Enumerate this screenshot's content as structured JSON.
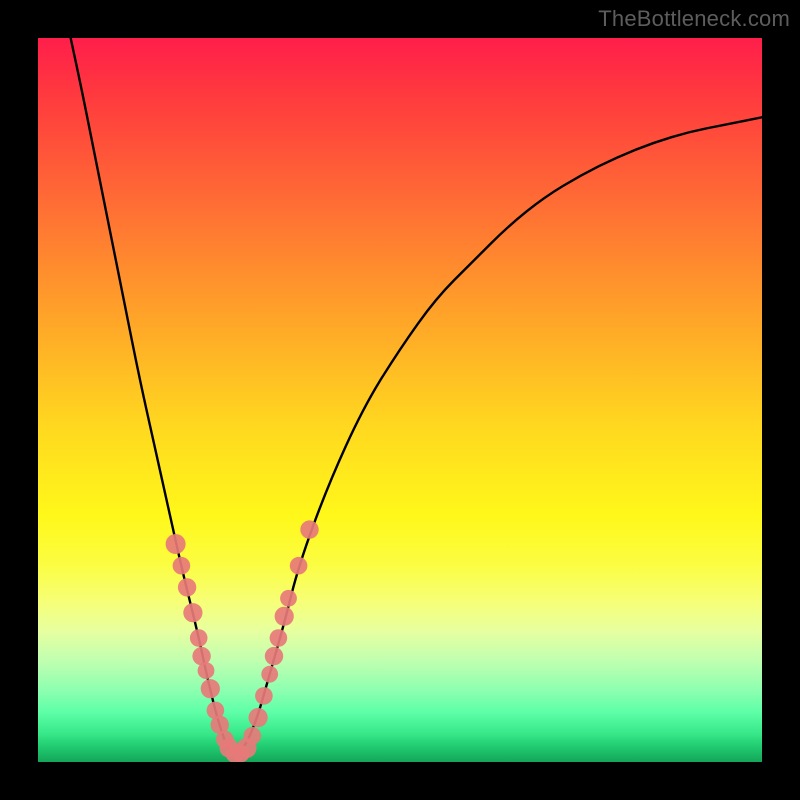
{
  "watermark": "TheBottleneck.com",
  "colors": {
    "frame": "#000000",
    "curve_stroke": "#000000",
    "marker_fill": "#e77a79",
    "gradient_stops": [
      {
        "pct": 0,
        "color": "#ff1e4b"
      },
      {
        "pct": 8,
        "color": "#ff3a3e"
      },
      {
        "pct": 22,
        "color": "#ff6a35"
      },
      {
        "pct": 38,
        "color": "#ffa229"
      },
      {
        "pct": 54,
        "color": "#ffd91f"
      },
      {
        "pct": 66,
        "color": "#fff81a"
      },
      {
        "pct": 73,
        "color": "#fbfd44"
      },
      {
        "pct": 78,
        "color": "#f6ff78"
      },
      {
        "pct": 82,
        "color": "#e6ffa0"
      },
      {
        "pct": 86,
        "color": "#c0ffb0"
      },
      {
        "pct": 90,
        "color": "#8effb0"
      },
      {
        "pct": 93,
        "color": "#5fffa8"
      },
      {
        "pct": 96,
        "color": "#38e98a"
      },
      {
        "pct": 98,
        "color": "#20c96f"
      },
      {
        "pct": 100,
        "color": "#14a559"
      }
    ]
  },
  "chart_data": {
    "type": "line",
    "title": "",
    "xlabel": "",
    "ylabel": "",
    "x_range": [
      0,
      100
    ],
    "y_range": [
      0,
      100
    ],
    "note": "V-shaped bottleneck curve. x is normalized horizontal position (0-100), y is bottleneck percentage (0 = optimal/green, 100 = severe/red). Minimum near x≈27.",
    "series": [
      {
        "name": "bottleneck-curve",
        "x": [
          4.5,
          6,
          8,
          10,
          12,
          14,
          16,
          18,
          20,
          22,
          23.5,
          25,
          26.5,
          28,
          30,
          32,
          34,
          36,
          40,
          45,
          50,
          55,
          60,
          65,
          70,
          75,
          80,
          85,
          90,
          95,
          100
        ],
        "y": [
          100,
          93,
          83,
          73,
          63,
          53,
          44,
          35,
          26,
          18,
          11,
          5,
          1,
          1,
          5,
          12,
          19,
          27,
          38,
          49,
          57,
          64,
          69,
          74,
          78,
          81,
          83.5,
          85.5,
          87,
          88,
          89
        ]
      }
    ],
    "markers": {
      "name": "highlighted-points",
      "note": "Salmon colored dots clustered near the curve minimum, sizes vary.",
      "points": [
        {
          "x": 19.0,
          "y": 30.0,
          "r": 1.5
        },
        {
          "x": 19.8,
          "y": 27.0,
          "r": 1.2
        },
        {
          "x": 20.6,
          "y": 24.0,
          "r": 1.3
        },
        {
          "x": 21.4,
          "y": 20.5,
          "r": 1.4
        },
        {
          "x": 22.2,
          "y": 17.0,
          "r": 1.2
        },
        {
          "x": 22.6,
          "y": 14.5,
          "r": 1.3
        },
        {
          "x": 23.2,
          "y": 12.5,
          "r": 1.1
        },
        {
          "x": 23.8,
          "y": 10.0,
          "r": 1.4
        },
        {
          "x": 24.5,
          "y": 7.0,
          "r": 1.2
        },
        {
          "x": 25.1,
          "y": 5.0,
          "r": 1.3
        },
        {
          "x": 25.8,
          "y": 3.0,
          "r": 1.2
        },
        {
          "x": 26.4,
          "y": 1.8,
          "r": 1.4
        },
        {
          "x": 27.2,
          "y": 1.0,
          "r": 1.3
        },
        {
          "x": 28.0,
          "y": 1.0,
          "r": 1.2
        },
        {
          "x": 28.8,
          "y": 1.8,
          "r": 1.5
        },
        {
          "x": 29.6,
          "y": 3.5,
          "r": 1.2
        },
        {
          "x": 30.4,
          "y": 6.0,
          "r": 1.4
        },
        {
          "x": 31.2,
          "y": 9.0,
          "r": 1.2
        },
        {
          "x": 32.0,
          "y": 12.0,
          "r": 1.1
        },
        {
          "x": 32.6,
          "y": 14.5,
          "r": 1.3
        },
        {
          "x": 33.2,
          "y": 17.0,
          "r": 1.2
        },
        {
          "x": 34.0,
          "y": 20.0,
          "r": 1.4
        },
        {
          "x": 34.6,
          "y": 22.5,
          "r": 1.1
        },
        {
          "x": 36.0,
          "y": 27.0,
          "r": 1.2
        },
        {
          "x": 37.5,
          "y": 32.0,
          "r": 1.3
        }
      ]
    }
  }
}
